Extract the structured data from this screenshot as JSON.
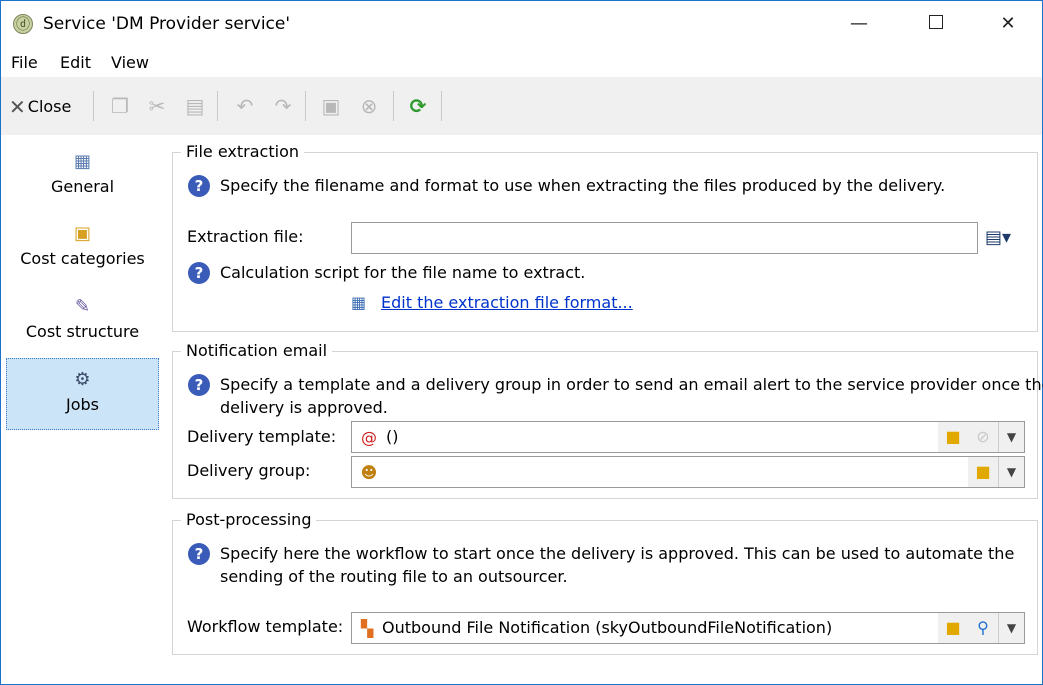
{
  "window": {
    "title": "Service 'DM Provider service'",
    "controls": {
      "minimize": "—",
      "close": "✕"
    }
  },
  "menu": {
    "items": [
      {
        "label": "File"
      },
      {
        "label": "Edit"
      },
      {
        "label": "View"
      }
    ]
  },
  "toolbar": {
    "close_label": "Close",
    "icons": [
      "copy-icon",
      "cut-icon",
      "paste-icon",
      "undo-icon",
      "redo-icon",
      "save-icon",
      "cancel-icon",
      "refresh-icon"
    ]
  },
  "sidebar": {
    "items": [
      {
        "label": "General",
        "icon": "general-icon",
        "active": false
      },
      {
        "label": "Cost categories",
        "icon": "cost-categories-icon",
        "active": false
      },
      {
        "label": "Cost structure",
        "icon": "cost-structure-icon",
        "active": false
      },
      {
        "label": "Jobs",
        "icon": "jobs-icon",
        "active": true
      }
    ]
  },
  "file_extraction": {
    "title": "File extraction",
    "help": "Specify the filename and format to use when extracting the files produced by the delivery.",
    "extraction_file_label": "Extraction file:",
    "extraction_file_value": "",
    "script_help": "Calculation script for the file name to extract.",
    "edit_link": "Edit the extraction file format..."
  },
  "notification_email": {
    "title": "Notification email",
    "help_line1": "Specify a template and a delivery group in order to send an email alert to the service provider once the",
    "help_line2": "delivery is approved.",
    "template_label": "Delivery template:",
    "template_value": "()",
    "group_label": "Delivery group:",
    "group_value": ""
  },
  "post_processing": {
    "title": "Post-processing",
    "help_line1": "Specify here the workflow to start once the delivery is approved. This can be used to automate the",
    "help_line2": "sending of the routing file to an outsourcer.",
    "workflow_label": "Workflow template:",
    "workflow_value": "Outbound File Notification (skyOutboundFileNotification)"
  },
  "colors": {
    "accent": "#1a73c8",
    "link": "#0033cc",
    "active_tab": "#cce4f7",
    "help_icon": "#3a5bb8"
  }
}
